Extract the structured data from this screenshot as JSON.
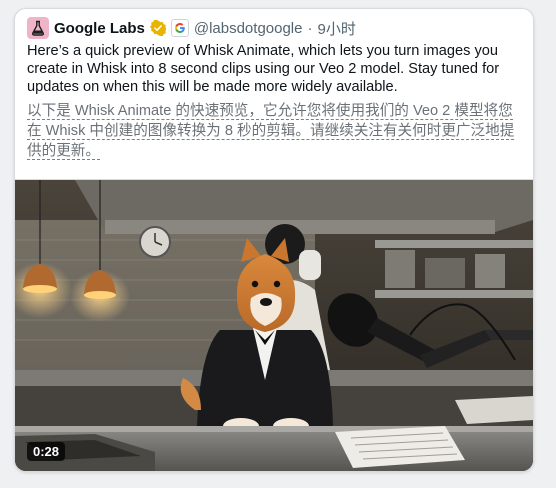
{
  "tweet": {
    "author_name": "Google Labs",
    "handle": "@labsdotgoogle",
    "separator": "·",
    "time": "9小时",
    "text_en": "Here’s a quick preview of Whisk Animate, which lets you turn images you create in Whisk into 8 second clips using our Veo 2 model. Stay tuned for updates on when this will be made more widely available.",
    "text_cn": "以下是 Whisk Animate 的快速预览，它允许您将使用我们的 Veo 2 模型将您在 Whisk 中创建的图像转换为 8 秒的剪辑。请继续关注有关何时更广泛地提供的更新。"
  },
  "video": {
    "duration": "0:28"
  },
  "icons": {
    "avatar": "flask-icon",
    "verified": "verified-badge-icon",
    "affiliate": "google-g-icon"
  },
  "colors": {
    "verified_gold": "#e8b400",
    "avatar_bg": "#f0b4c8",
    "text_primary": "#0f1419",
    "text_secondary": "#536471"
  }
}
